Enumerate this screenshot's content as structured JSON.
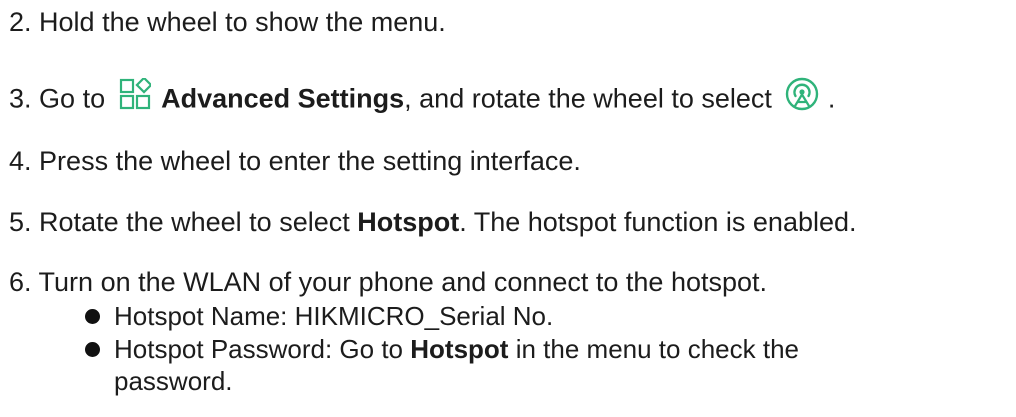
{
  "colors": {
    "text": "#1c1c1c",
    "icon_accent": "#2fb37a"
  },
  "steps": [
    {
      "number": "2.",
      "text": "Hold the wheel to show the menu."
    },
    {
      "number": "3.",
      "pre": "Go to",
      "icon1": "advanced-settings-icon",
      "bold": "Advanced Settings",
      "mid": ", and rotate the wheel to select",
      "icon2": "hotspot-icon",
      "post": "."
    },
    {
      "number": "4.",
      "text": "Press the wheel to enter the setting interface."
    },
    {
      "number": "5.",
      "pre": "Rotate the wheel to select",
      "bold": "Hotspot",
      "post": ". The hotspot function is enabled."
    },
    {
      "number": "6.",
      "text": "Turn on the WLAN of your phone and connect to the hotspot."
    }
  ],
  "bullets": [
    {
      "text": "Hotspot Name: HIKMICRO_Serial No."
    },
    {
      "pre": "Hotspot Password: Go to",
      "bold": "Hotspot",
      "post": "in the menu to check the",
      "continuation": "password."
    }
  ]
}
